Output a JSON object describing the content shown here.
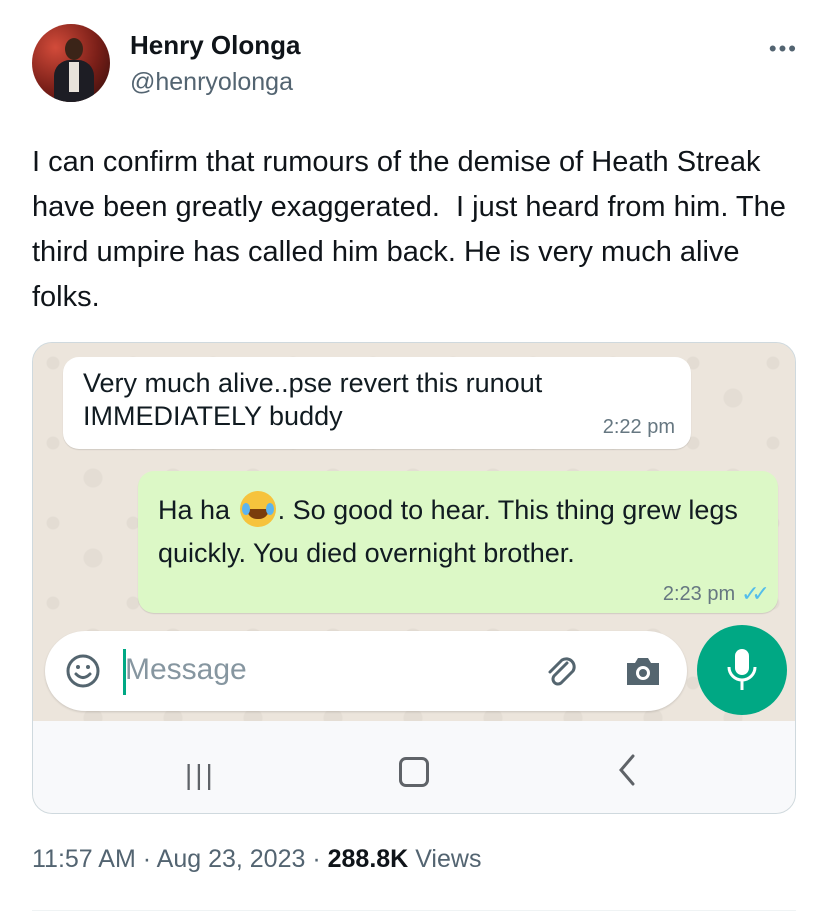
{
  "author": {
    "name": "Henry Olonga",
    "handle": "@henryolonga"
  },
  "tweet": {
    "text": "I can confirm that rumours of the demise of Heath Streak have been greatly exaggerated.  I just heard from him. The third umpire has called him back. He is very much alive folks.",
    "timestamp": "11:57 AM",
    "separator": "·",
    "date": "Aug 23, 2023",
    "views_count": "288.8K",
    "views_label": "Views"
  },
  "chat": {
    "incoming": {
      "text": "Very much alive..pse revert this runout\nIMMEDIATELY buddy",
      "time": "2:22 pm"
    },
    "outgoing": {
      "text_before_emoji": "Ha ha ",
      "emoji": "face-with-tears-of-joy",
      "text_after_emoji": ".  So good to hear. This thing grew legs quickly. You died overnight brother.",
      "time": "2:23 pm",
      "status": "read"
    },
    "composer": {
      "placeholder": "Message"
    }
  },
  "colors": {
    "whatsapp_green": "#00a884",
    "outgoing_bubble": "#dcf8c6",
    "read_ticks": "#53bdeb",
    "secondary_text": "#536471"
  },
  "icons": [
    "more-icon",
    "smiley-icon",
    "attach-icon",
    "camera-icon",
    "mic-icon",
    "nav-recent-icon",
    "nav-home-icon",
    "nav-back-icon",
    "read-ticks-icon"
  ]
}
